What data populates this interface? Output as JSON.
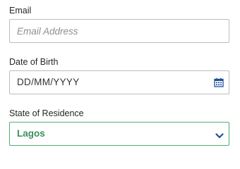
{
  "email": {
    "label": "Email",
    "placeholder": "Email Address",
    "value": ""
  },
  "dob": {
    "label": "Date of Birth",
    "value": "DD/MM/YYYY",
    "icon": "calendar-icon"
  },
  "state": {
    "label": "State of Residence",
    "selected": "Lagos",
    "icon": "chevron-down-icon"
  },
  "colors": {
    "accent": "#3a8f5a",
    "active_border": "#4caf72",
    "icon_blue": "#1f4f99",
    "border": "#bdbdbd"
  }
}
